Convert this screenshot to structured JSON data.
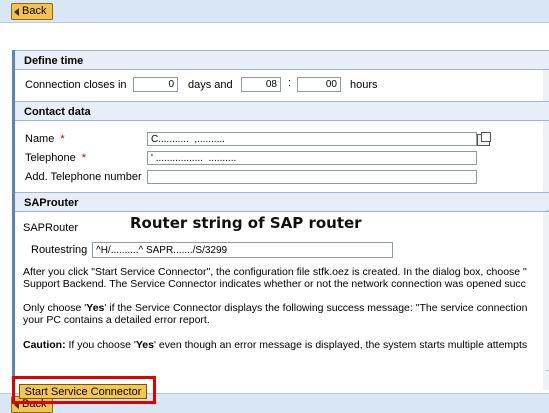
{
  "nav": {
    "back_label": "Back"
  },
  "define_time": {
    "title": "Define time",
    "connection_label": "Connection closes in",
    "days_value": "0",
    "days_label": "days and",
    "hours_value": "08",
    "separator": ":",
    "minutes_value": "00",
    "hours_label": "hours"
  },
  "contact": {
    "title": "Contact data",
    "name_label": "Name",
    "name_value": "C...........  ,..........",
    "telephone_label": "Telephone",
    "telephone_value": "' .................  ..........",
    "add_phone_label": "Add. Telephone number",
    "add_phone_value": "",
    "required_mark": "*"
  },
  "saprouter": {
    "title": "SAProuter",
    "label": "SAPRouter",
    "routestring_label": "Routestring",
    "routestring_value": "^H/..........^ SAPR......./S/3299",
    "annotation": "Router string of SAP router"
  },
  "info": {
    "para1_line1": "After you click \"Start Service Connector\", the configuration file stfk.oez is created. In the dialog box, choose \"",
    "para1_line2": "Support Backend. The Service Connector indicates whether or not the network connection was opened succ",
    "para2_prefix": "Only choose '",
    "para2_yes": "Yes",
    "para2_rest": "' if the Service Connector displays the following success message: \"The service connection",
    "para2_line2": "your PC contains a detailed error report.",
    "caution_label": "Caution:",
    "caution_prefix": " If you choose '",
    "caution_yes": "Yes",
    "caution_rest": "' even though an error message is displayed, the system starts multiple attempts"
  },
  "actions": {
    "start_label": "Start Service Connector"
  },
  "colors": {
    "section_header": "#e8eef7",
    "button": "#f7c64d",
    "highlight": "#e00000",
    "accent": "#5b85c2"
  }
}
